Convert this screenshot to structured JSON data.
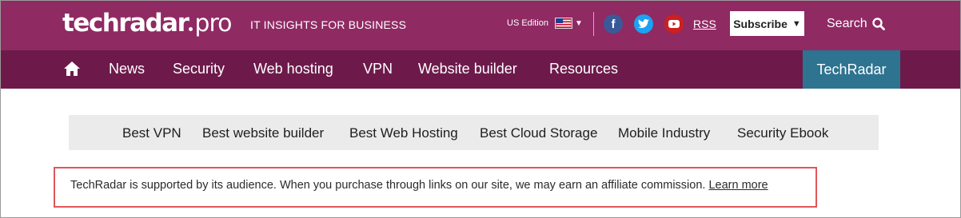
{
  "header": {
    "logo": {
      "tech": "techradar",
      "pro": "pro"
    },
    "tagline": "IT INSIGHTS FOR BUSINESS",
    "edition": "US Edition",
    "rss": "RSS",
    "subscribe": "Subscribe",
    "search": "Search",
    "colors": {
      "top_bar": "#8f2a63",
      "nav_bar": "#6d1a4b",
      "techradar_tab": "#2e7390"
    }
  },
  "nav": {
    "items": [
      "News",
      "Security",
      "Web hosting",
      "VPN",
      "Website builder",
      "Resources"
    ],
    "right_tab": "TechRadar"
  },
  "subnav": {
    "items": [
      "Best VPN",
      "Best website builder",
      "Best Web Hosting",
      "Best Cloud Storage",
      "Mobile Industry",
      "Security Ebook"
    ]
  },
  "notice": {
    "text": "TechRadar is supported by its audience. When you purchase through links on our site, we may earn an affiliate commission. ",
    "link": "Learn more",
    "highlight_color": "#e0555a"
  },
  "icons": [
    "home-icon",
    "facebook-icon",
    "twitter-icon",
    "youtube-icon",
    "search-icon",
    "us-flag-icon"
  ]
}
